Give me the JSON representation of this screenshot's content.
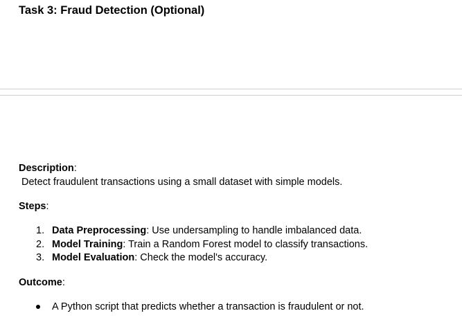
{
  "document": {
    "title": "Task 3: Fraud Detection (Optional)",
    "description": {
      "heading": "Description",
      "colon": ":",
      "text": "Detect fraudulent transactions using a small dataset with simple models."
    },
    "steps": {
      "heading": "Steps",
      "colon": ":",
      "items": [
        {
          "number": "1.",
          "label": "Data Preprocessing",
          "text": ": Use undersampling to handle imbalanced data."
        },
        {
          "number": "2.",
          "label": "Model Training",
          "text": ": Train a Random Forest model to classify transactions."
        },
        {
          "number": "3.",
          "label": "Model Evaluation",
          "text": ": Check the model's accuracy."
        }
      ]
    },
    "outcome": {
      "heading": "Outcome",
      "colon": ":",
      "items": [
        {
          "text": "A Python script that predicts whether a transaction is fraudulent or not."
        }
      ]
    }
  }
}
